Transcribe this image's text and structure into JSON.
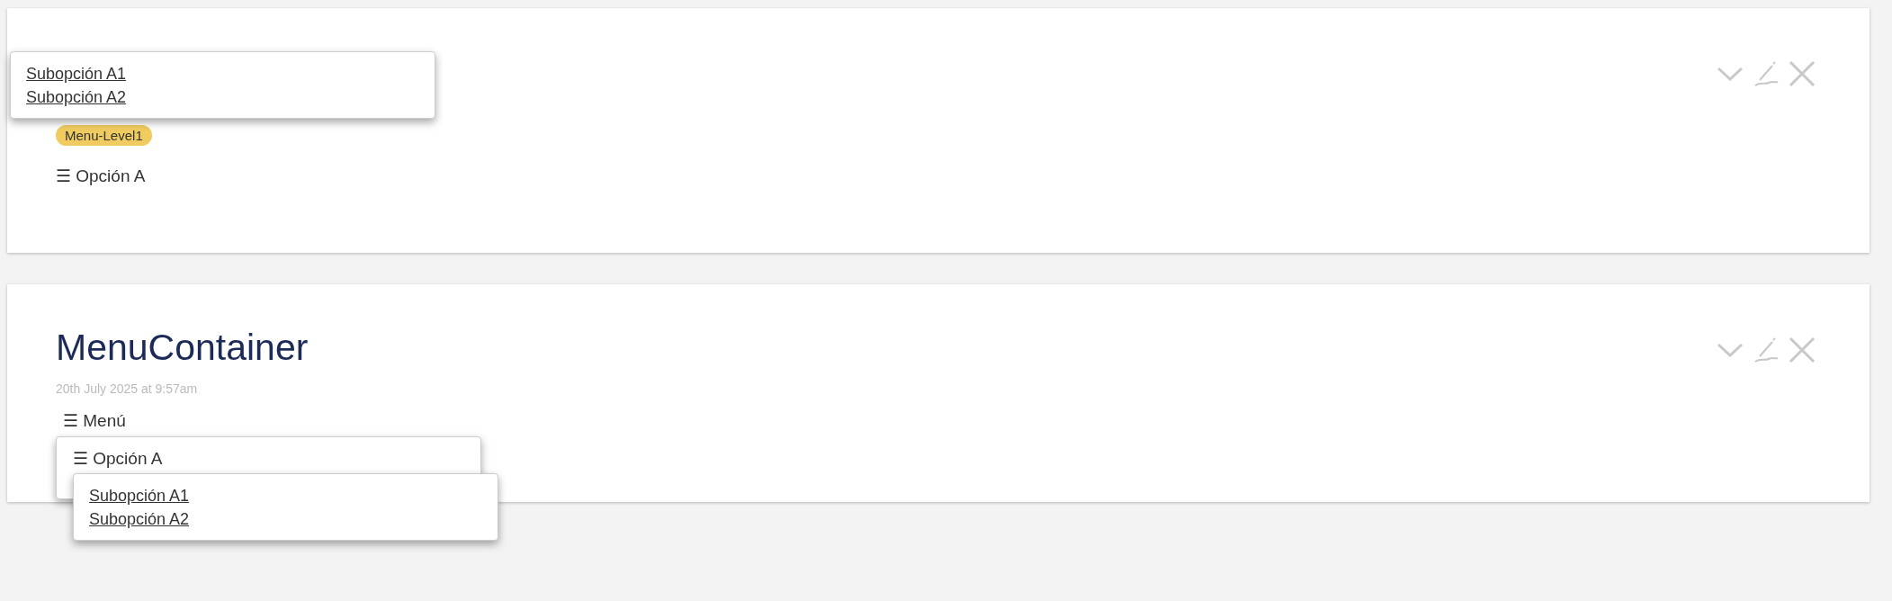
{
  "cards": [
    {
      "kind": "level",
      "badge": "Menu-Level1",
      "option": "☰ Opción A",
      "popup": {
        "items": [
          "Subopción A1",
          "Subopción A2"
        ]
      }
    },
    {
      "kind": "container",
      "title": "MenuContainer",
      "date": "20th July 2025 at 9:57am",
      "menu": {
        "label": "☰ Menú",
        "submenu": {
          "label": "☰ Opción A",
          "items": [
            "Subopción A1",
            "Subopción A2"
          ]
        }
      }
    }
  ]
}
